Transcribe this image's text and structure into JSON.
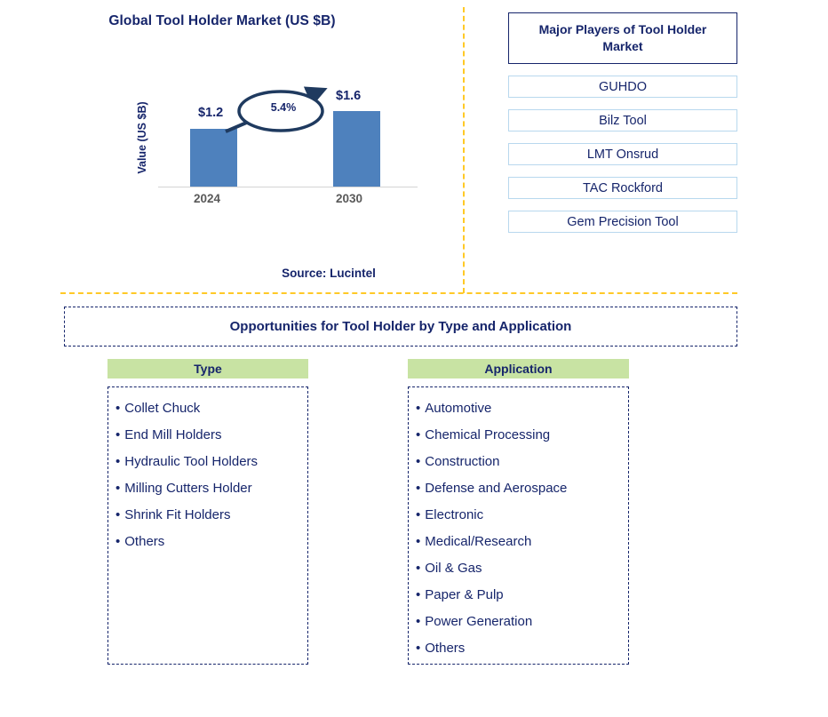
{
  "chart_panel": {
    "title": "Global Tool Holder Market (US $B)",
    "y_axis_label": "Value (US $B)",
    "source": "Source: Lucintel",
    "cagr_label": "5.4%"
  },
  "chart_data": {
    "type": "bar",
    "title": "Global Tool Holder Market (US $B)",
    "categories": [
      "2024",
      "2030"
    ],
    "values": [
      1.2,
      1.6
    ],
    "data_labels": [
      "$1.2",
      "$1.6"
    ],
    "xlabel": "",
    "ylabel": "Value (US $B)",
    "ylim": [
      0,
      1.85
    ],
    "grid": false,
    "legend": "none",
    "series_color": "#4E81BD",
    "annotations": [
      {
        "text": "5.4%",
        "kind": "cagr-callout",
        "from": "2024",
        "to": "2030"
      }
    ]
  },
  "players": {
    "header": "Major Players of Tool Holder Market",
    "items": [
      "GUHDO",
      "Bilz Tool",
      "LMT Onsrud",
      "TAC Rockford",
      "Gem Precision Tool"
    ]
  },
  "opportunities": {
    "banner": "Opportunities for Tool Holder by Type and Application",
    "type": {
      "header": "Type",
      "items": [
        "Collet Chuck",
        "End Mill Holders",
        "Hydraulic Tool Holders",
        "Milling Cutters Holder",
        "Shrink Fit Holders",
        "Others"
      ]
    },
    "application": {
      "header": "Application",
      "items": [
        "Automotive",
        "Chemical Processing",
        "Construction",
        "Defense and Aerospace",
        "Electronic",
        "Medical/Research",
        "Oil & Gas",
        "Paper & Pulp",
        "Power Generation",
        "Others"
      ]
    }
  },
  "colors": {
    "navy": "#16256B",
    "bar_blue": "#4E81BD",
    "divider_gold": "#FFC926",
    "header_green": "#C8E3A3",
    "player_border": "#B8D8EE"
  }
}
